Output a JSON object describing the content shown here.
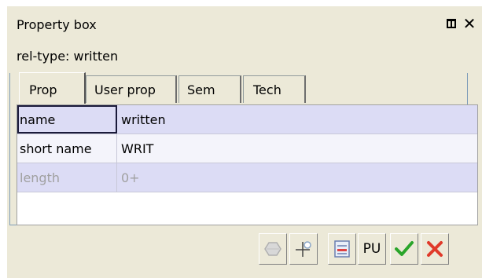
{
  "panel": {
    "title": "Property box",
    "restore_icon": "restore-window-icon",
    "close_glyph": "✕",
    "subtitle": "rel-type: written"
  },
  "tabs": [
    {
      "label": "Prop",
      "active": true
    },
    {
      "label": "User prop",
      "active": false
    },
    {
      "label": "Sem",
      "active": false
    },
    {
      "label": "Tech",
      "active": false
    }
  ],
  "properties": [
    {
      "name": "name",
      "value": "written",
      "editable": true
    },
    {
      "name": "short name",
      "value": "WRIT",
      "editable": true
    },
    {
      "name": "length",
      "value": "0+",
      "editable": false
    }
  ],
  "toolbar": {
    "buttons": [
      {
        "icon": "hexagon-disabled-icon",
        "enabled": false
      },
      {
        "icon": "crosshair-icon",
        "enabled": true
      },
      {
        "icon": "form-icon",
        "enabled": true
      },
      {
        "icon": "pu-text-icon",
        "label": "PU",
        "enabled": true
      },
      {
        "icon": "check-icon",
        "enabled": true
      },
      {
        "icon": "cross-icon",
        "enabled": true
      }
    ]
  },
  "colors": {
    "panel_bg": "#ece9d8",
    "row_shaded": "#dcdcf5",
    "check_green": "#2aa52a",
    "cross_red": "#e03a2a"
  }
}
